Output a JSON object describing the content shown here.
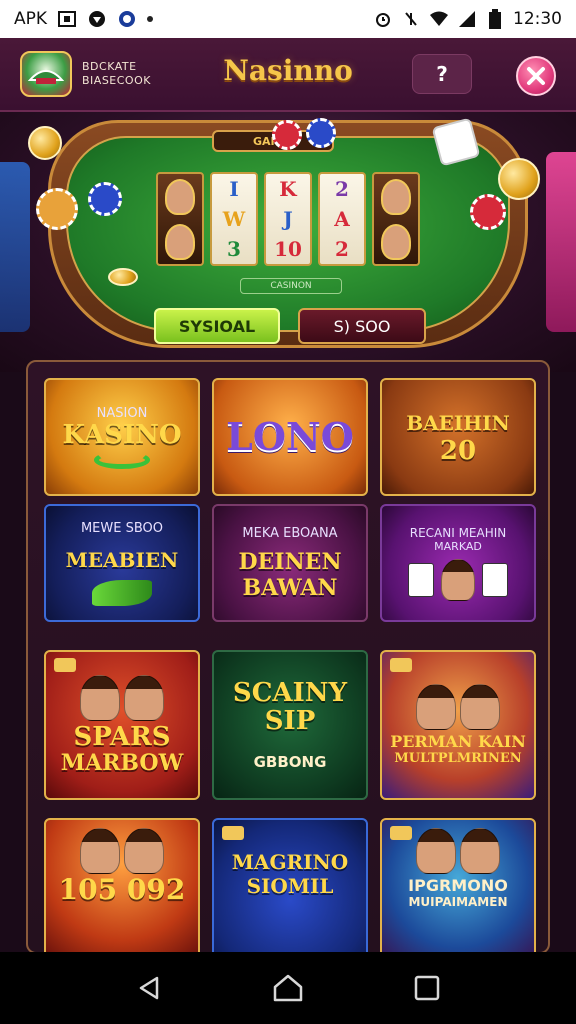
{
  "status_bar": {
    "left_text": "APK",
    "time": "12:30",
    "icons": [
      "image-icon",
      "shield-icon",
      "vpn-icon",
      "dot-icon",
      "alarm-icon",
      "vibrate-icon",
      "wifi-icon",
      "signal-icon",
      "battery-icon"
    ]
  },
  "header": {
    "logo_line1": "BDCKATE",
    "logo_line2": "BIASECOOK",
    "title": "Nasinno",
    "help_label": "?",
    "close_icon": "close-icon"
  },
  "table": {
    "tag": "GAIOD",
    "reels": [
      [
        "",
        "",
        ""
      ],
      [
        "I",
        "W",
        "3"
      ],
      [
        "K",
        "J",
        "10"
      ],
      [
        "2",
        "A",
        "2"
      ],
      [
        "",
        "",
        ""
      ]
    ],
    "label": "CASINON",
    "green_button": "SYSIOAL",
    "maroon_button": "S) SOO"
  },
  "tiles": [
    {
      "top": "NASION",
      "title": "KASINO",
      "sub": ""
    },
    {
      "top": "",
      "title": "LONO",
      "sub": ""
    },
    {
      "top": "",
      "title": "BAEIHIN",
      "sub": "20"
    },
    {
      "top": "MEWE SBOO",
      "title": "MEABIEN",
      "sub": ""
    },
    {
      "top": "MEKA EBOANA",
      "title": "DEINEN BAWAN",
      "sub": ""
    },
    {
      "top": "RECANI MEAHIN",
      "title": "MARKAD",
      "sub": ""
    },
    {
      "top": "",
      "title": "SPARS",
      "sub": "MARBOW"
    },
    {
      "top": "",
      "title": "SCAINY SIP",
      "sub": "GBBONG"
    },
    {
      "top": "",
      "title": "PERMAN KAIN",
      "sub": "MULTPLMRINEN"
    },
    {
      "top": "",
      "title": "105 092",
      "sub": ""
    },
    {
      "top": "",
      "title": "MAGRINO SIOMIL",
      "sub": ""
    },
    {
      "top": "",
      "title": "IPGRMONO",
      "sub": "MUIPAIMAMEN"
    }
  ],
  "nav": {
    "back_icon": "back-icon",
    "home_icon": "home-icon",
    "recents_icon": "recents-icon"
  },
  "colors": {
    "accent_gold": "#f6c64a",
    "header_bg": "#4a1838",
    "felt_green": "#1f7a28",
    "close_pink": "#e23b7d"
  }
}
